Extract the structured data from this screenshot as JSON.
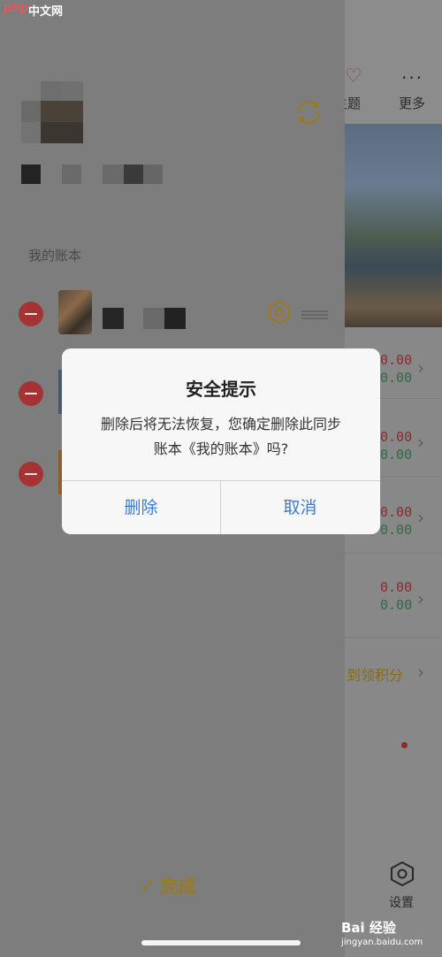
{
  "watermark": {
    "brand_php": "php",
    "brand_cn": "中文网"
  },
  "main": {
    "tab_theme": "主题",
    "tab_more": "更多",
    "rows": [
      {
        "red": "0.00",
        "green": "0.00"
      },
      {
        "red": "0.00",
        "green": "0.00"
      },
      {
        "red": "0.00",
        "green": "0.00"
      },
      {
        "red": "0.00",
        "green": "0.00"
      }
    ],
    "checkin_text": "到领积分",
    "settings_label": "设置"
  },
  "drawer": {
    "section_title": "我的账本",
    "done_label": "完成"
  },
  "dialog": {
    "title": "安全提示",
    "message": "删除后将无法恢复，您确定删除此同步账本《我的账本》吗?",
    "delete_label": "删除",
    "cancel_label": "取消"
  },
  "footer_watermark": {
    "brand": "Bai 经验",
    "url": "jingyan.baidu.com"
  },
  "colors": {
    "accent": "#3a7bd5",
    "danger": "#a63333",
    "gold": "#9a7a20"
  }
}
